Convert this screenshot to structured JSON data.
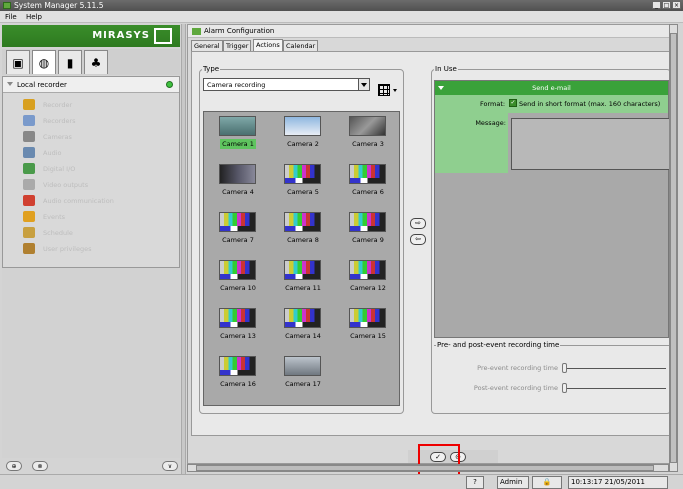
{
  "window": {
    "title": "System Manager 5.11.5",
    "buttons": [
      "_",
      "□",
      "×"
    ]
  },
  "menu": {
    "file": "File",
    "help": "Help"
  },
  "brand": {
    "logo_text": "MIRASYS"
  },
  "left_tabs": [
    "servers-icon",
    "cameras-icon",
    "device-icon",
    "users-icon"
  ],
  "tree": {
    "root_label": "Local recorder",
    "root_status_color": "#3fc03f",
    "items": [
      {
        "label": "Recorder",
        "icon": "recorder-icon"
      },
      {
        "label": "Recorders",
        "icon": "recorders-icon"
      },
      {
        "label": "Cameras",
        "icon": "camera-icon"
      },
      {
        "label": "Audio",
        "icon": "audio-icon"
      },
      {
        "label": "Digital I/O",
        "icon": "digital-io-icon"
      },
      {
        "label": "Video outputs",
        "icon": "video-output-icon"
      },
      {
        "label": "Audio communication",
        "icon": "audio-communication-icon"
      },
      {
        "label": "Events",
        "icon": "events-icon"
      },
      {
        "label": "Schedule",
        "icon": "schedule-icon"
      },
      {
        "label": "User privileges",
        "icon": "user-privileges-icon"
      }
    ]
  },
  "alarm": {
    "header": "Alarm Configuration",
    "tabs": [
      "General",
      "Trigger",
      "Actions",
      "Calendar"
    ],
    "active_tab": "Actions"
  },
  "type_group": {
    "title": "Type",
    "selected": "Camera recording"
  },
  "cameras": [
    {
      "label": "Camera 1",
      "selected": true
    },
    {
      "label": "Camera 2"
    },
    {
      "label": "Camera 3"
    },
    {
      "label": "Camera 4"
    },
    {
      "label": "Camera 5"
    },
    {
      "label": "Camera 6"
    },
    {
      "label": "Camera 7"
    },
    {
      "label": "Camera 8"
    },
    {
      "label": "Camera 9"
    },
    {
      "label": "Camera 10"
    },
    {
      "label": "Camera 11"
    },
    {
      "label": "Camera 12"
    },
    {
      "label": "Camera 13"
    },
    {
      "label": "Camera 14"
    },
    {
      "label": "Camera 15"
    },
    {
      "label": "Camera 16"
    },
    {
      "label": "Camera 17"
    }
  ],
  "in_use": {
    "title": "In Use",
    "action_header": "Send e-mail",
    "format_label": "Format:",
    "format_checkbox_text": "Send in short format (max. 160 characters)",
    "format_checked": true,
    "message_label": "Message:"
  },
  "prepost": {
    "title": "Pre- and post-event recording time",
    "pre_label": "Pre-event recording time",
    "post_label": "Post-event recording time"
  },
  "status": {
    "user": "Admin",
    "datetime": "10:13:17 21/05/2011"
  },
  "colors": {
    "brand_green": "#3a8d2a",
    "header_green": "#3aa23a",
    "highlight_red": "#e00000"
  }
}
